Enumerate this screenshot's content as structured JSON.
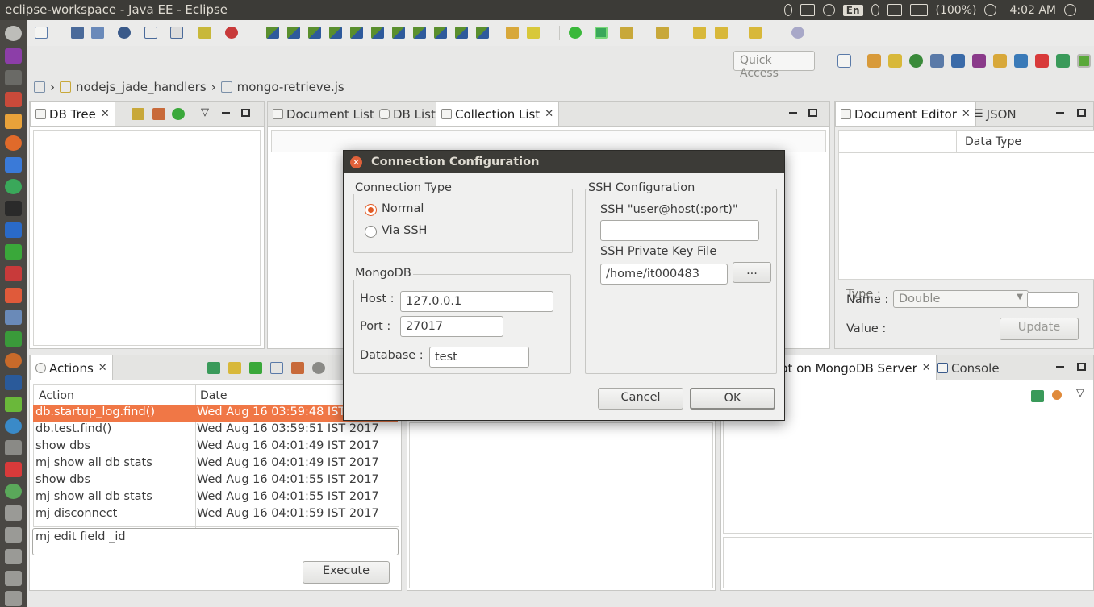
{
  "window": {
    "title": "eclipse-workspace - Java EE - Eclipse",
    "lang": "En",
    "battery": "(100%)",
    "clock": "4:02 AM"
  },
  "toolbar": {
    "quick_access": "Quick Access"
  },
  "breadcrumb": {
    "project": "nodejs_jade_handlers",
    "file": "mongo-retrieve.js"
  },
  "db_tree": {
    "tab": "DB Tree"
  },
  "center_tabs": [
    {
      "label": "Document List"
    },
    {
      "label": "DB List"
    },
    {
      "label": "Collection List"
    }
  ],
  "right_tabs": [
    {
      "label": "Document Editor"
    },
    {
      "label": "JSON"
    }
  ],
  "document_editor": {
    "col_data_type": "Data Type",
    "type_label": "Type :",
    "name_label": "Name :",
    "type_value": "Double",
    "value_label": "Value :",
    "update": "Update"
  },
  "actions": {
    "tab": "Actions",
    "col_action": "Action",
    "col_date": "Date",
    "rows": [
      {
        "action": "db.startup_log.find()",
        "date": "Wed Aug 16 03:59:48 IST 2017"
      },
      {
        "action": "db.test.find()",
        "date": "Wed Aug 16 03:59:51 IST 2017"
      },
      {
        "action": "show dbs",
        "date": "Wed Aug 16 04:01:49 IST 2017"
      },
      {
        "action": "mj show all db stats",
        "date": "Wed Aug 16 04:01:49 IST 2017"
      },
      {
        "action": "show dbs",
        "date": "Wed Aug 16 04:01:55 IST 2017"
      },
      {
        "action": "mj show all db stats",
        "date": "Wed Aug 16 04:01:55 IST 2017"
      },
      {
        "action": "mj disconnect",
        "date": "Wed Aug 16 04:01:59 IST 2017"
      }
    ],
    "command": "mj edit field _id",
    "execute": "Execute"
  },
  "bottom_right_tabs": [
    {
      "label": "pt on MongoDB Server"
    },
    {
      "label": "Console"
    }
  ],
  "dialog": {
    "title": "Connection Configuration",
    "connection_type": {
      "title": "Connection Type",
      "normal": "Normal",
      "via_ssh": "Via SSH",
      "selected": "Normal"
    },
    "mongodb": {
      "title": "MongoDB",
      "host_label": "Host :",
      "host": "127.0.0.1",
      "port_label": "Port :",
      "port": "27017",
      "database_label": "Database :",
      "database": "test"
    },
    "ssh": {
      "title": "SSH Configuration",
      "user_label": "SSH \"user@host(:port)\"",
      "user_value": "",
      "key_label": "SSH Private Key File",
      "key_value": "/home/it000483",
      "browse": "..."
    },
    "cancel": "Cancel",
    "ok": "OK"
  },
  "colors": {
    "selection": "#f07746",
    "radio_on": "#e15a24",
    "titlebar": "#3c3b37"
  }
}
